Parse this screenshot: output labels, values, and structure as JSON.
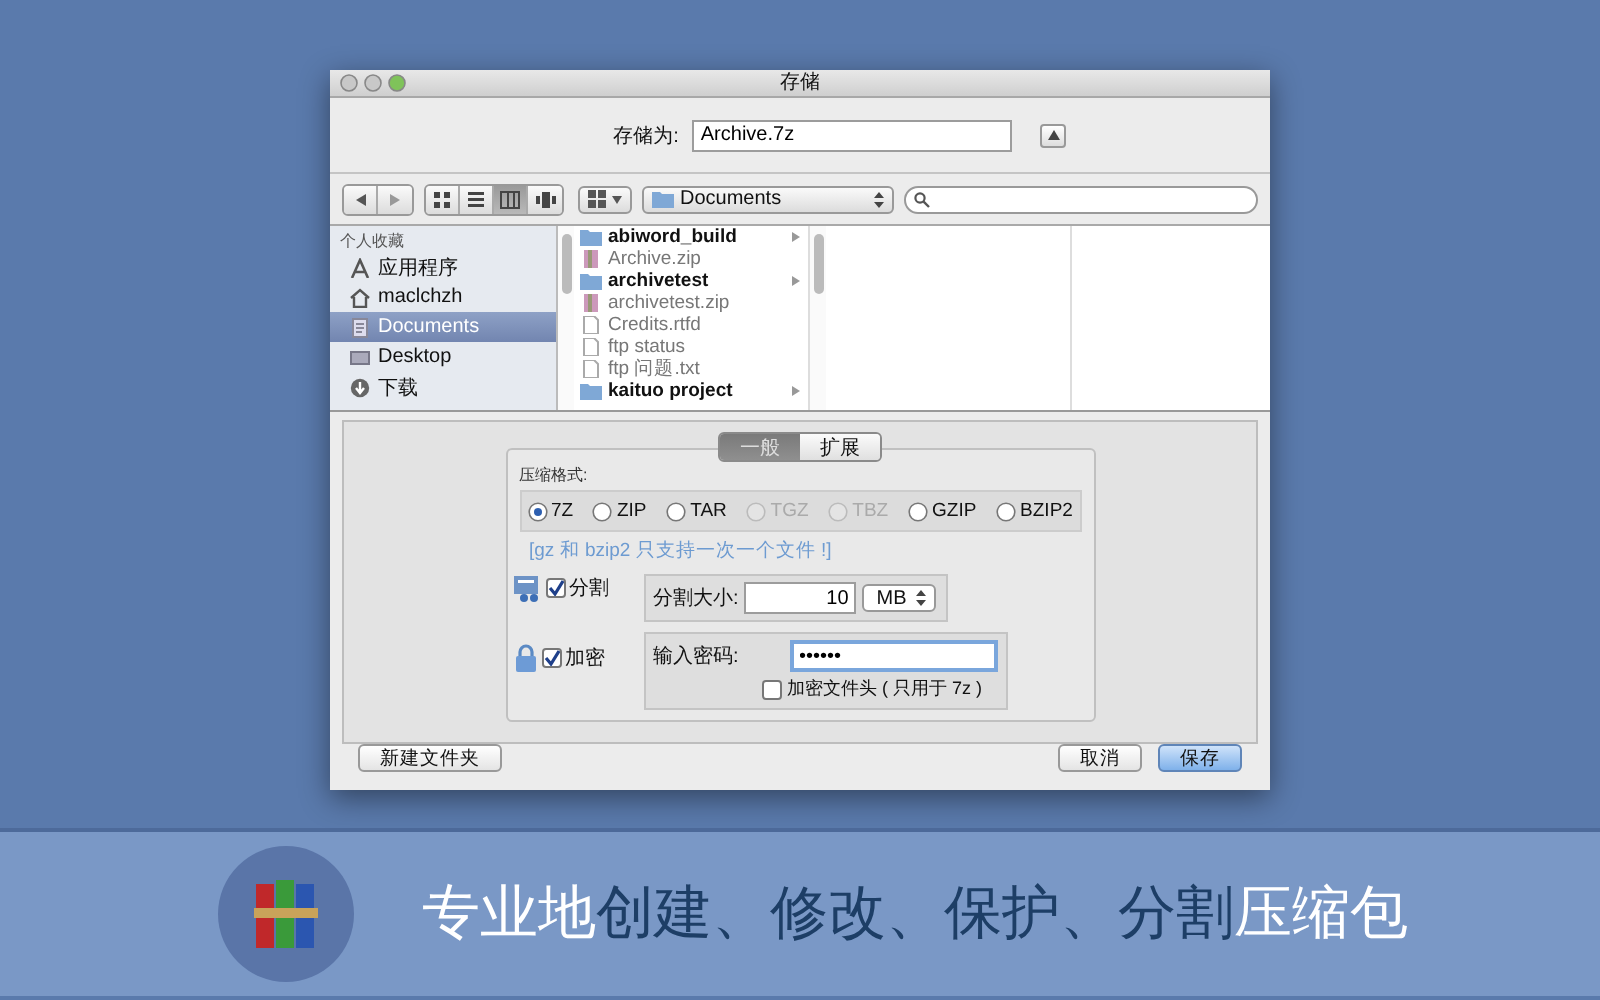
{
  "window": {
    "title": "存储"
  },
  "save_as": {
    "label": "存储为:",
    "value": "Archive.7z"
  },
  "toolbar": {
    "views": [
      {
        "selected": false
      },
      {
        "selected": false
      },
      {
        "selected": true
      },
      {
        "selected": false
      }
    ],
    "location": "Documents"
  },
  "sidebar": {
    "heading": "个人收藏",
    "items": [
      {
        "label": "应用程序",
        "kind": "apps",
        "selected": false
      },
      {
        "label": "maclchzh",
        "kind": "home",
        "selected": false
      },
      {
        "label": "Documents",
        "kind": "documents",
        "selected": true
      },
      {
        "label": "Desktop",
        "kind": "desktop",
        "selected": false
      },
      {
        "label": "下载",
        "kind": "downloads",
        "selected": false
      }
    ]
  },
  "files": [
    {
      "name": "abiword_build",
      "kind": "folder"
    },
    {
      "name": "Archive.zip",
      "kind": "archive"
    },
    {
      "name": "archivetest",
      "kind": "folder"
    },
    {
      "name": "archivetest.zip",
      "kind": "archive"
    },
    {
      "name": "Credits.rtfd",
      "kind": "document"
    },
    {
      "name": "ftp status",
      "kind": "document"
    },
    {
      "name": "ftp 问题.txt",
      "kind": "document"
    },
    {
      "name": "kaituo project",
      "kind": "folder"
    }
  ],
  "tabs": [
    {
      "label": "一般",
      "selected": true
    },
    {
      "label": "扩展",
      "selected": false
    }
  ],
  "formats": {
    "label": "压缩格式:",
    "options": [
      {
        "label": "7Z",
        "selected": true,
        "disabled": false
      },
      {
        "label": "ZIP",
        "selected": false,
        "disabled": false
      },
      {
        "label": "TAR",
        "selected": false,
        "disabled": false
      },
      {
        "label": "TGZ",
        "selected": false,
        "disabled": true
      },
      {
        "label": "TBZ",
        "selected": false,
        "disabled": true
      },
      {
        "label": "GZIP",
        "selected": false,
        "disabled": false
      },
      {
        "label": "BZIP2",
        "selected": false,
        "disabled": false
      }
    ]
  },
  "note": "[gz 和 bzip2 只支持一次一个文件 !]",
  "split": {
    "label": "分割",
    "checked": true,
    "size_label": "分割大小:",
    "size_value": "10",
    "unit": "MB"
  },
  "encrypt": {
    "label": "加密",
    "checked": true,
    "password_label": "输入密码:",
    "password": "••••••",
    "header_label": "加密文件头 ( 只用于 7z )",
    "header_checked": false
  },
  "buttons": [
    {
      "label": "新建文件夹",
      "kind": "plain"
    },
    {
      "label": "取消",
      "kind": "plain"
    },
    {
      "label": "保存",
      "kind": "default"
    }
  ],
  "banner": {
    "parts": [
      {
        "text": "专业地",
        "highlight": false
      },
      {
        "text": "创建、修改、保护、分割",
        "highlight": true
      },
      {
        "text": "压缩包",
        "highlight": false
      }
    ]
  }
}
